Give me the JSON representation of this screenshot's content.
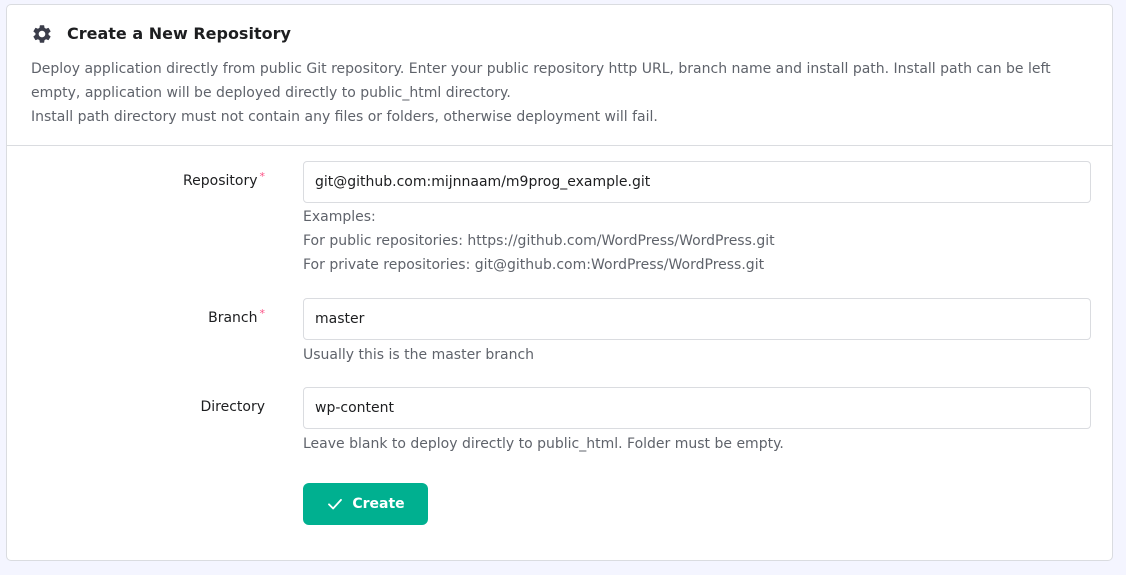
{
  "header": {
    "title": "Create a New Repository",
    "icon": "gear-icon",
    "description_line1": "Deploy application directly from public Git repository. Enter your public repository http URL, branch name and install path. Install path can be left empty, application will be deployed directly to public_html directory.",
    "description_line2": "Install path directory must not contain any files or folders, otherwise deployment will fail."
  },
  "form": {
    "repository": {
      "label": "Repository",
      "required_mark": "*",
      "value": "git@github.com:mijnnaam/m9prog_example.git",
      "hint_title": "Examples:",
      "hint_public": "For public repositories: https://github.com/WordPress/WordPress.git",
      "hint_private": "For private repositories: git@github.com:WordPress/WordPress.git"
    },
    "branch": {
      "label": "Branch",
      "required_mark": "*",
      "value": "master",
      "hint": "Usually this is the master branch"
    },
    "directory": {
      "label": "Directory",
      "value": "wp-content",
      "hint": "Leave blank to deploy directly to public_html. Folder must be empty."
    },
    "submit": {
      "label": "Create",
      "icon": "check-icon"
    }
  },
  "colors": {
    "accent": "#00b090",
    "required": "#fc5185",
    "text": "#1d1e20",
    "muted": "#5f636b",
    "border": "#dadce0",
    "page_background": "#f4f5ff"
  }
}
